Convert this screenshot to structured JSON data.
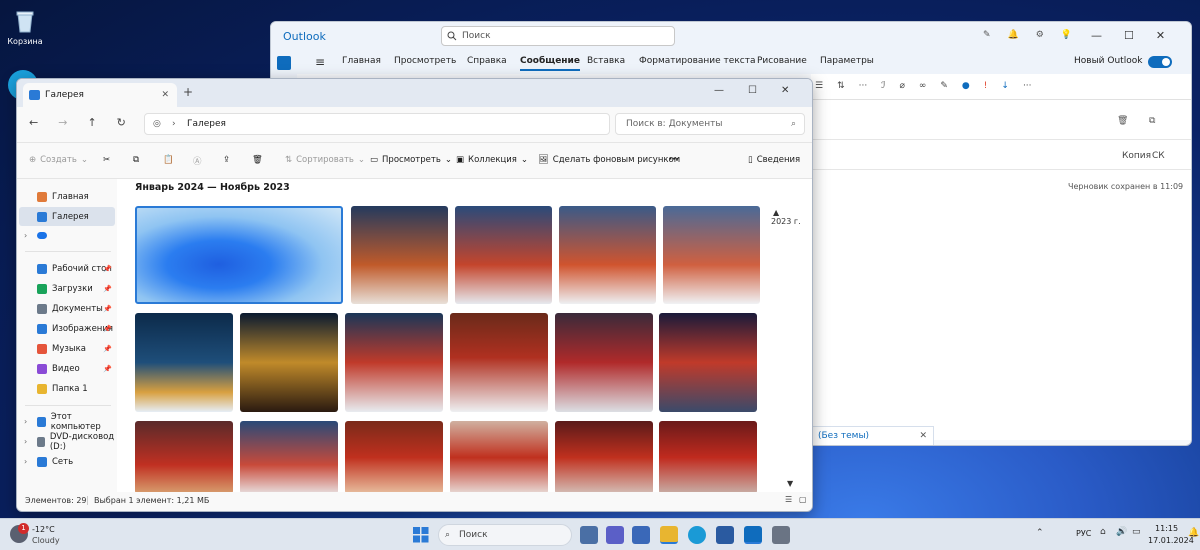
{
  "desktop": {
    "recycle_label": "Корзина"
  },
  "outlook": {
    "app_name": "Outlook",
    "search_placeholder": "Поиск",
    "tabs": [
      "Главная",
      "Просмотреть",
      "Справка",
      "Сообщение",
      "Вставка",
      "Форматирование текста",
      "Рисование",
      "Параметры"
    ],
    "active_tab": "Сообщение",
    "new_outlook_label": "Новый Outlook",
    "copy_label": "Копия",
    "bcc_label": "СК",
    "draft_saved": "Черновик сохранен в 11:09",
    "draft_tab": "(Без темы)"
  },
  "explorer": {
    "tab_title": "Галерея",
    "address": "Галерея",
    "search_placeholder": "Поиск в: Документы",
    "commands": {
      "create": "Создать",
      "sort": "Сортировать",
      "view": "Просмотреть",
      "collection": "Коллекция",
      "wallpaper": "Сделать фоновым рисунком",
      "details": "Сведения"
    },
    "nav": [
      {
        "label": "Главная",
        "icon": "home-icon",
        "color": "#e07a3a"
      },
      {
        "label": "Галерея",
        "icon": "gallery-icon",
        "color": "#2a7ad6",
        "selected": true
      },
      {
        "label": "",
        "icon": "onedrive-icon",
        "color": "#1a73e8"
      },
      {
        "label": "Рабочий стол",
        "icon": "desktop-folder-icon",
        "color": "#2a7ad6",
        "pinned": true
      },
      {
        "label": "Загрузки",
        "icon": "downloads-folder-icon",
        "color": "#19a35a",
        "pinned": true
      },
      {
        "label": "Документы",
        "icon": "documents-folder-icon",
        "color": "#6c7a8a",
        "pinned": true
      },
      {
        "label": "Изображения",
        "icon": "pictures-folder-icon",
        "color": "#2a7ad6",
        "pinned": true
      },
      {
        "label": "Музыка",
        "icon": "music-folder-icon",
        "color": "#e5553b",
        "pinned": true
      },
      {
        "label": "Видео",
        "icon": "videos-folder-icon",
        "color": "#8a4bd6",
        "pinned": true
      },
      {
        "label": "Папка 1",
        "icon": "folder-icon",
        "color": "#e8b530"
      },
      {
        "label": "Этот компьютер",
        "icon": "this-pc-icon",
        "color": "#2a7ad6"
      },
      {
        "label": "DVD-дисковод (D:)",
        "icon": "dvd-drive-icon",
        "color": "#6c7a8a"
      },
      {
        "label": "Сеть",
        "icon": "network-icon",
        "color": "#2a7ad6"
      }
    ],
    "group_heading": "Январь 2024 — Ноябрь 2023",
    "timeline_label": "2023 г.",
    "status_count": "Элементов: 29",
    "status_selected": "Выбран 1 элемент: 1,21 МБ"
  },
  "taskbar": {
    "temperature": "-12°C",
    "weather": "Cloudy",
    "search": "Поиск",
    "lang": "РУС",
    "time": "11:15",
    "date": "17.01.2024"
  }
}
